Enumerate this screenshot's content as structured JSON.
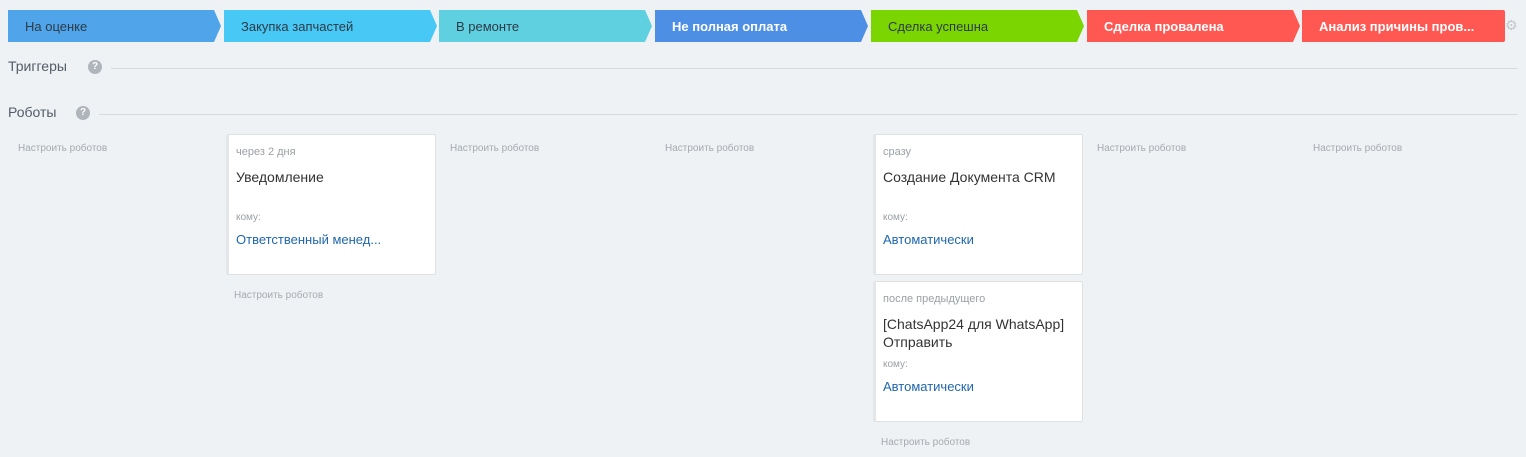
{
  "stages": [
    {
      "label": "На оценке",
      "bg": "#4fa4ea",
      "color": "#2e3a46"
    },
    {
      "label": "Закупка запчастей",
      "bg": "#47c8f5",
      "color": "#2e3a46"
    },
    {
      "label": "В ремонте",
      "bg": "#5fd0df",
      "color": "#2e3a46"
    },
    {
      "label": "Не полная оплата",
      "bg": "#4d8fe4",
      "color": "#ffffff"
    },
    {
      "label": "Сделка успешна",
      "bg": "#7bd500",
      "color": "#2e3a46"
    },
    {
      "label": "Сделка провалена",
      "bg": "#ff5752",
      "color": "#ffffff"
    },
    {
      "label": "Анализ причины пров...",
      "bg": "#ff5752",
      "color": "#ffffff"
    }
  ],
  "triggers": {
    "title": "Триггеры",
    "help": "?"
  },
  "robots": {
    "title": "Роботы",
    "help": "?",
    "setup_label": "Настроить роботов",
    "columns": [
      {
        "cards": []
      },
      {
        "cards": [
          {
            "delay": "через 2 дня",
            "name": "Уведомление",
            "to_label": "кому:",
            "to_value": "Ответственный менед..."
          }
        ]
      },
      {
        "cards": []
      },
      {
        "cards": []
      },
      {
        "cards": [
          {
            "delay": "сразу",
            "name": "Создание Документа CRM",
            "to_label": "кому:",
            "to_value": "Автоматически"
          },
          {
            "delay": "после предыдущего",
            "name": "[ChatsApp24 для WhatsApp] Отправить",
            "to_label": "кому:",
            "to_value": "Автоматически"
          }
        ]
      },
      {
        "cards": []
      },
      {
        "cards": []
      }
    ]
  },
  "icons": {
    "settings": "gear-icon",
    "help": "question-icon"
  },
  "colors": {
    "link": "#2067b0",
    "background": "#eef2f4"
  }
}
